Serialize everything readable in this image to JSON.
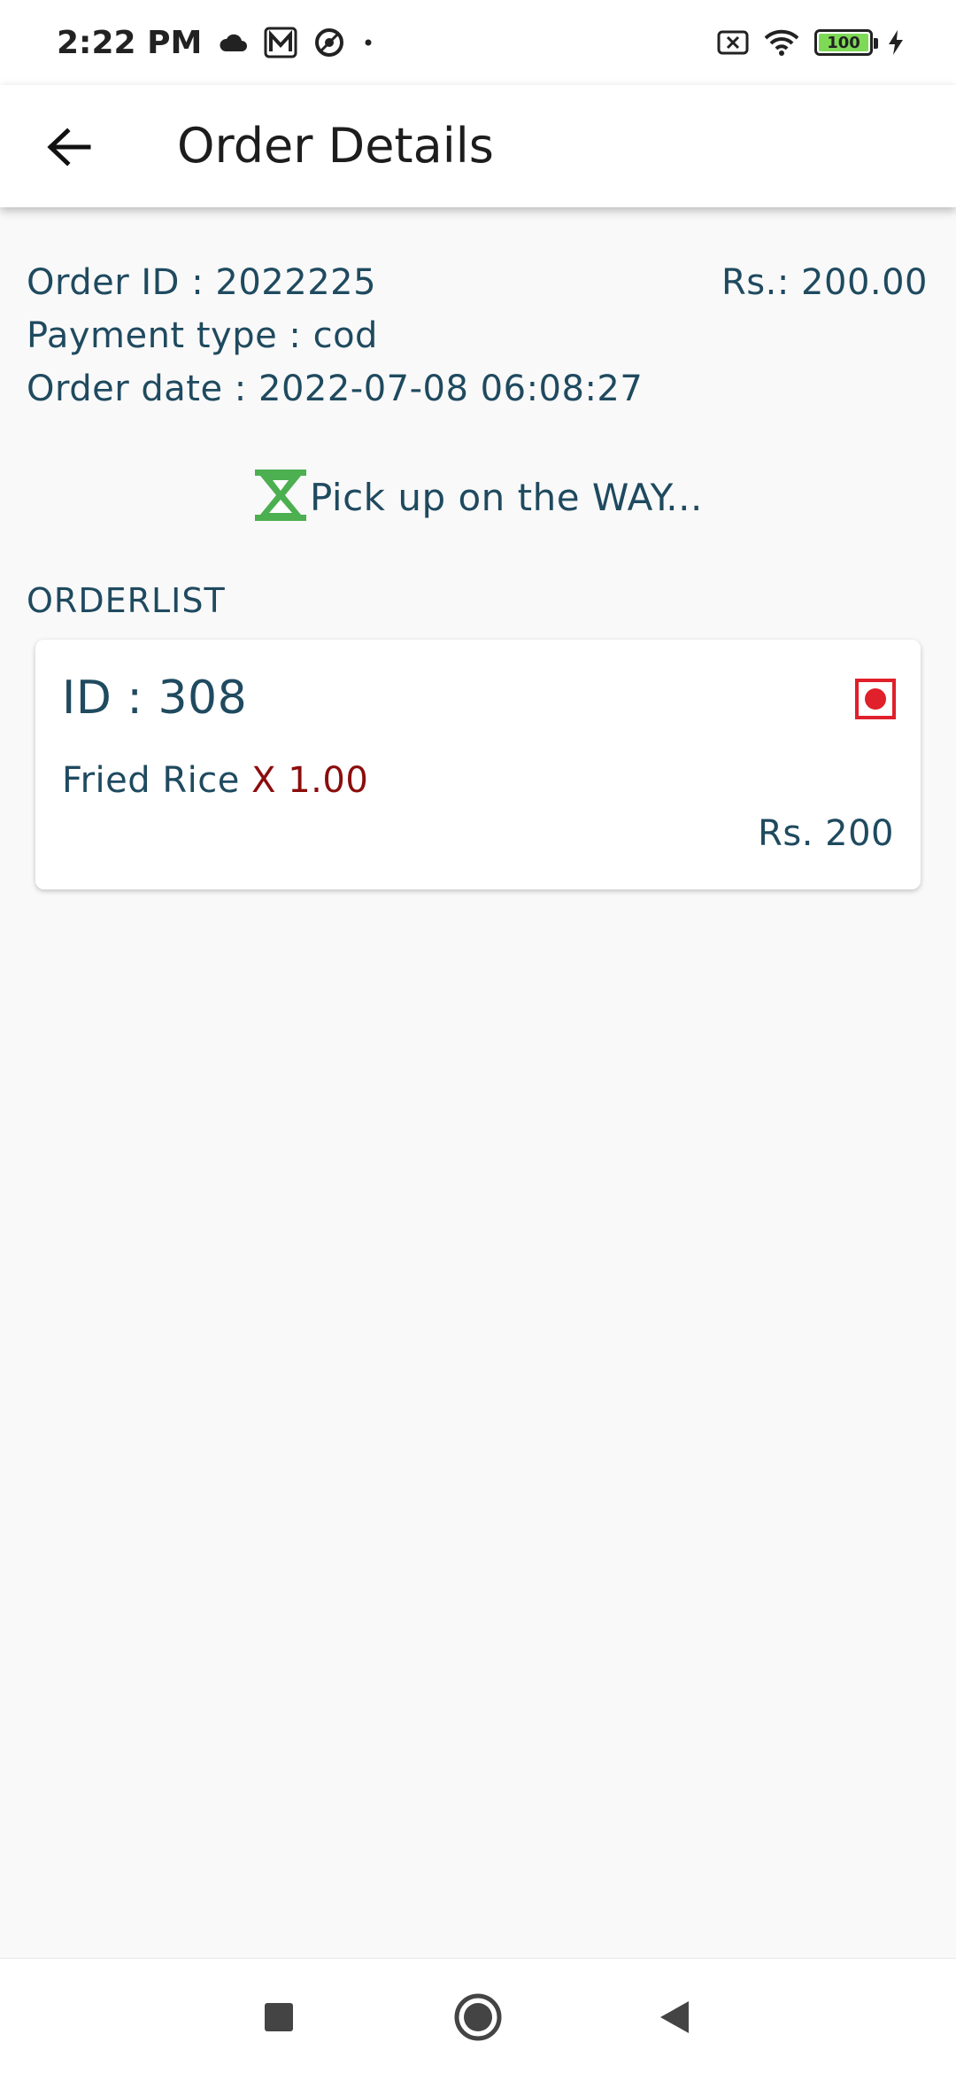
{
  "status_bar": {
    "time": "2:22 PM",
    "battery_level": "100"
  },
  "app_bar": {
    "title": "Order Details"
  },
  "order": {
    "id_text": "Order ID : 2022225",
    "amount_text": "Rs.: 200.00",
    "payment_text": "Payment type :  cod",
    "date_text": "Order date : 2022-07-08 06:08:27",
    "status_text": "Pick up on the WAY..."
  },
  "orderlist": {
    "label": "ORDERLIST",
    "items": [
      {
        "id_text": "ID : 308",
        "name": "Fried Rice ",
        "qty": "X 1.00",
        "price": "Rs. 200"
      }
    ]
  },
  "colors": {
    "text_primary": "#1f4a5f",
    "quantity": "#8b0d0d",
    "status_icon": "#4caf50",
    "indicator": "#e0202a"
  }
}
